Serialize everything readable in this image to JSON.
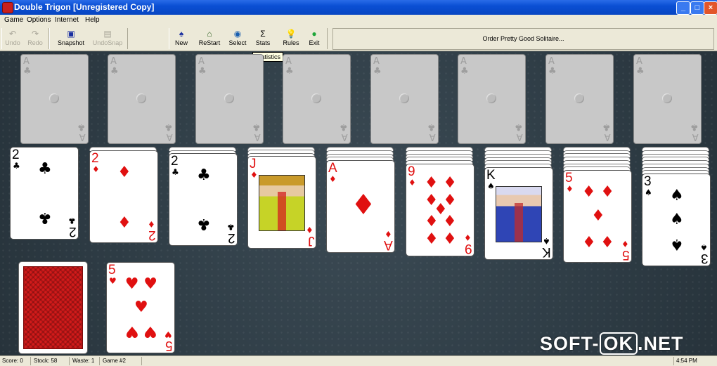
{
  "window": {
    "title": "Double Trigon [Unregistered Copy]",
    "minimize": "_",
    "maximize": "□",
    "close": "×"
  },
  "menu": [
    "Game",
    "Options",
    "Internet",
    "Help"
  ],
  "toolbar": {
    "undo": {
      "label": "Undo",
      "icon": "↶"
    },
    "redo": {
      "label": "Redo",
      "icon": "↷"
    },
    "snapshot": {
      "label": "Snapshot",
      "icon": "▣"
    },
    "undosnap": {
      "label": "UndoSnap",
      "icon": "▤"
    },
    "new": {
      "label": "New",
      "icon": "♠"
    },
    "restart": {
      "label": "ReStart",
      "icon": "⌂"
    },
    "select": {
      "label": "Select",
      "icon": "◉"
    },
    "stats": {
      "label": "Stats",
      "icon": "Σ"
    },
    "rules": {
      "label": "Rules",
      "icon": "💡"
    },
    "exit": {
      "label": "Exit",
      "icon": "●"
    },
    "order": "Order Pretty Good Solitaire..."
  },
  "tooltip": "Statistics",
  "foundations": {
    "rank": "A",
    "suit": "♣",
    "count": 8
  },
  "tableau": [
    {
      "rank": "2",
      "suit": "♣",
      "color": "black"
    },
    {
      "rank": "2",
      "suit": "♦",
      "color": "red"
    },
    {
      "rank": "2",
      "suit": "♣",
      "color": "black"
    },
    {
      "rank": "J",
      "suit": "♦",
      "color": "red"
    },
    {
      "rank": "A",
      "suit": "♦",
      "color": "red"
    },
    {
      "rank": "9",
      "suit": "♦",
      "color": "red"
    },
    {
      "rank": "K",
      "suit": "♠",
      "color": "black"
    },
    {
      "rank": "5",
      "suit": "♦",
      "color": "red"
    },
    {
      "rank": "3",
      "suit": "♠",
      "color": "black"
    }
  ],
  "waste": {
    "rank": "5",
    "suit": "♥",
    "color": "red"
  },
  "watermark": {
    "left": "SOFT-",
    "box": "OK",
    "right": ".NET"
  },
  "status": {
    "score": "Score: 0",
    "stock": "Stock: 58",
    "waste": "Waste: 1",
    "game": "Game #2",
    "time": "4:54 PM"
  }
}
